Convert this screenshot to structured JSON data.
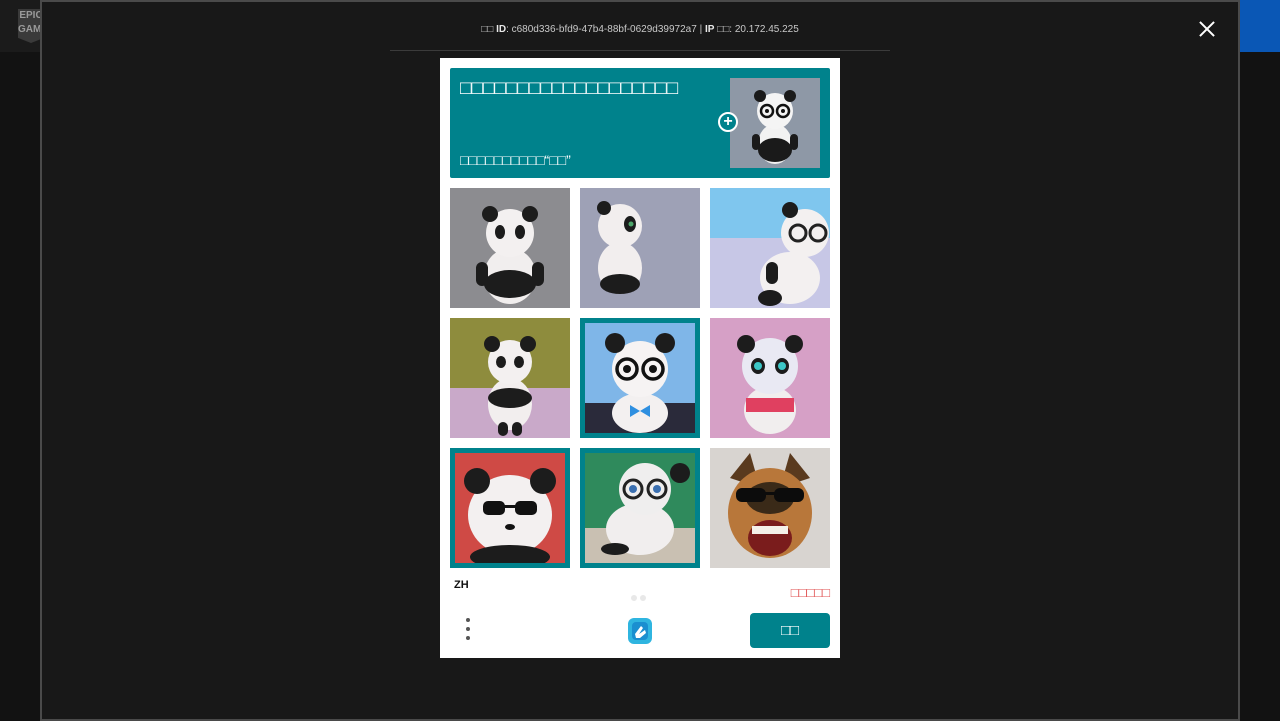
{
  "app": {
    "logo_text": "EPIC\nGAMES"
  },
  "overlay": {
    "ray_id_label": "ID",
    "ray_id_prefix": "□□",
    "ray_id_value": "c680d336-bfd9-47b4-88bf-0629d39972a7",
    "ip_label": "IP",
    "ip_prefix": "□□",
    "ip_value": "20.172.45.225"
  },
  "captcha": {
    "prompt_title": "□□□□□□□□□□□□□□□□□□□",
    "prompt_subtitle": "□□□□□□□□□□“□□”",
    "language": "ZH",
    "retry_label": "□□□□□",
    "verify_label": "□□",
    "tiles": [
      {
        "subject": "panda",
        "selected": false
      },
      {
        "subject": "panda",
        "selected": false
      },
      {
        "subject": "panda-glasses",
        "selected": false
      },
      {
        "subject": "panda",
        "selected": false
      },
      {
        "subject": "panda-glasses",
        "selected": true
      },
      {
        "subject": "panda",
        "selected": false
      },
      {
        "subject": "panda-glasses",
        "selected": true
      },
      {
        "subject": "panda-glasses",
        "selected": true
      },
      {
        "subject": "dog-sunglasses",
        "selected": false
      }
    ]
  },
  "colors": {
    "accent": "#00828c",
    "error": "#e05050"
  }
}
